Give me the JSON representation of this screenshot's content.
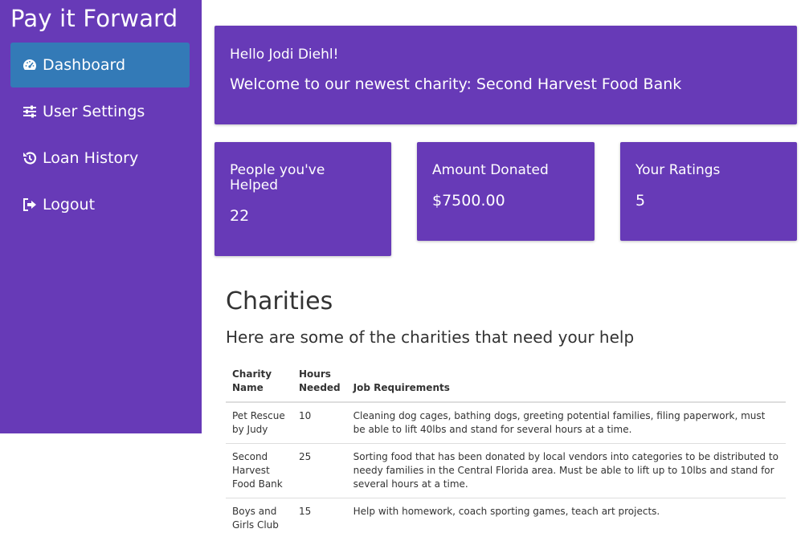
{
  "app": {
    "title": "Pay it Forward"
  },
  "sidebar": {
    "items": [
      {
        "label": "Dashboard",
        "icon": "dashboard-icon",
        "active": true
      },
      {
        "label": "User Settings",
        "icon": "sliders-icon",
        "active": false
      },
      {
        "label": "Loan History",
        "icon": "history-icon",
        "active": false
      },
      {
        "label": "Logout",
        "icon": "logout-icon",
        "active": false
      }
    ]
  },
  "welcome": {
    "hello": "Hello Jodi Diehl!",
    "newest": "Welcome to our newest charity: Second Harvest Food Bank"
  },
  "stats": [
    {
      "label": "People you've Helped",
      "value": "22"
    },
    {
      "label": "Amount Donated",
      "value": "$7500.00"
    },
    {
      "label": "Your Ratings",
      "value": "5"
    }
  ],
  "charities": {
    "title": "Charities",
    "subtitle": "Here are some of the charities that need your help",
    "headers": {
      "name": "Charity Name",
      "hours": "Hours Needed",
      "requirements": "Job Requirements"
    },
    "rows": [
      {
        "name": "Pet Rescue by Judy",
        "hours": "10",
        "requirements": "Cleaning dog cages, bathing dogs, greeting potential families, filing paperwork, must be able to lift 40lbs and stand for several hours at a time."
      },
      {
        "name": "Second Harvest Food Bank",
        "hours": "25",
        "requirements": "Sorting food that has been donated by local vendors into categories to be distributed to needy families in the Central Florida area. Must be able to lift up to 10lbs and stand for several hours at a time."
      },
      {
        "name": "Boys and Girls Club",
        "hours": "15",
        "requirements": "Help with homework, coach sporting games, teach art projects."
      }
    ]
  },
  "colors": {
    "primary": "#673ab7",
    "active": "#337ab7",
    "text": "#333333"
  }
}
